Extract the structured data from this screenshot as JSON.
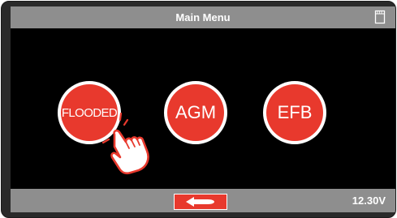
{
  "header": {
    "title": "Main Menu",
    "storage_icon": "sd-card-icon"
  },
  "menu": {
    "buttons": [
      {
        "label": "FLOODED",
        "icon": "circle-button"
      },
      {
        "label": "AGM",
        "icon": "circle-button"
      },
      {
        "label": "EFB",
        "icon": "circle-button"
      }
    ],
    "pointer_icon": "hand-tap-icon"
  },
  "footer": {
    "back_icon": "return-arrow-icon",
    "voltage": "12.30V"
  },
  "colors": {
    "accent_red": "#e8392d",
    "bar_gray": "#8e8e8e",
    "screen_bg": "#000000",
    "text": "#ffffff"
  }
}
